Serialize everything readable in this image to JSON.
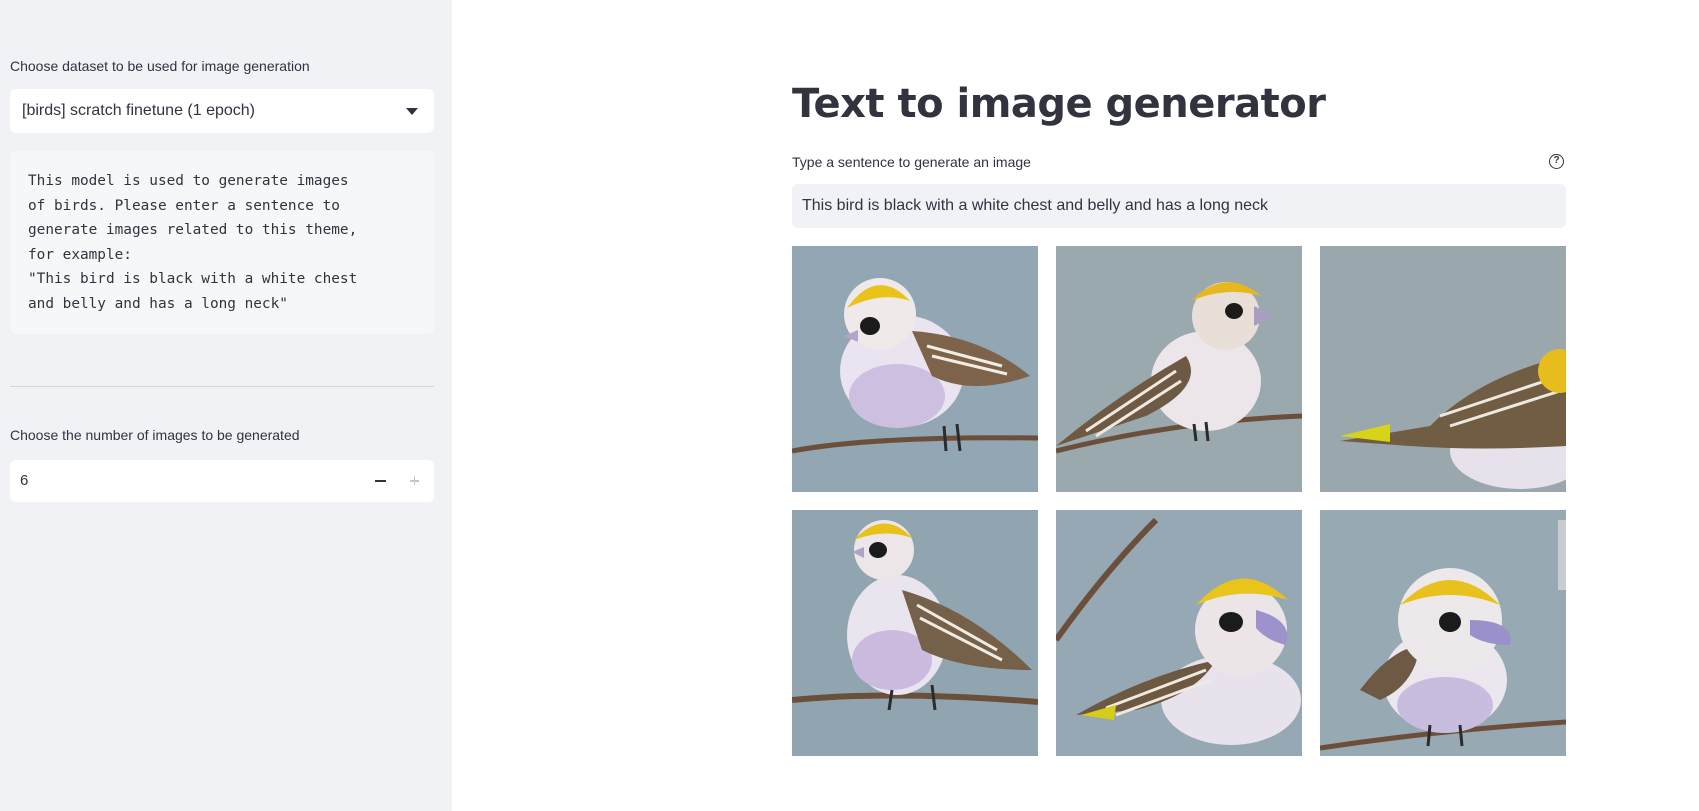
{
  "sidebar": {
    "dataset_label": "Choose dataset to be used for image generation",
    "dataset_selected": "[birds] scratch finetune (1 epoch)",
    "description": "This model is used to generate images\nof birds. Please enter a sentence to\ngenerate images related to this theme,\nfor example:\n\"This bird is black with a white chest\nand belly and has a long neck\"",
    "count_label": "Choose the number of images to be generated",
    "count_value": "6"
  },
  "main": {
    "title": "Text to image generator",
    "input_label": "Type a sentence to generate an image",
    "input_value": "This bird is black with a white chest and belly and has a long neck",
    "images": [
      {
        "name": "generated-bird-image-1"
      },
      {
        "name": "generated-bird-image-2"
      },
      {
        "name": "generated-bird-image-3"
      },
      {
        "name": "generated-bird-image-4"
      },
      {
        "name": "generated-bird-image-5"
      },
      {
        "name": "generated-bird-image-6"
      }
    ]
  },
  "icons": {
    "dropdown": "chevron-down-icon",
    "decrement": "minus-icon",
    "increment": "plus-icon",
    "help": "help-icon"
  },
  "colors": {
    "sidebar_bg": "#f0f2f6",
    "text": "#31333f",
    "input_bg": "#f0f2f6"
  }
}
